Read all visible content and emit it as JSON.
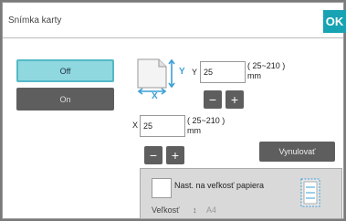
{
  "dialog": {
    "title": "Snímka karty",
    "ok_label": "OK"
  },
  "mode": {
    "off_label": "Off",
    "on_label": "On",
    "selected": "Off"
  },
  "paper_icon": {
    "name": "paper-dimension-icon",
    "x_axis": "X",
    "y_axis": "Y"
  },
  "y_setting": {
    "label": "Y",
    "value": "25",
    "range": "( 25~210 )",
    "unit": "mm",
    "minus": "−",
    "plus": "+"
  },
  "x_setting": {
    "label": "X",
    "value": "25",
    "range": "( 25~210 )",
    "unit": "mm",
    "minus": "−",
    "plus": "+"
  },
  "reset_label": "Vynulovať",
  "paper_size": {
    "checkbox_label": "Nast. na veľkosť papiera",
    "checked": false,
    "size_label": "Veľkosť",
    "size_arrow": "↕",
    "size_value": "A4"
  },
  "colors": {
    "accent": "#17a3b3",
    "selected_bg": "#8fd8e0",
    "button_bg": "#5e5e5e",
    "icon_blue": "#3a9fd6"
  }
}
